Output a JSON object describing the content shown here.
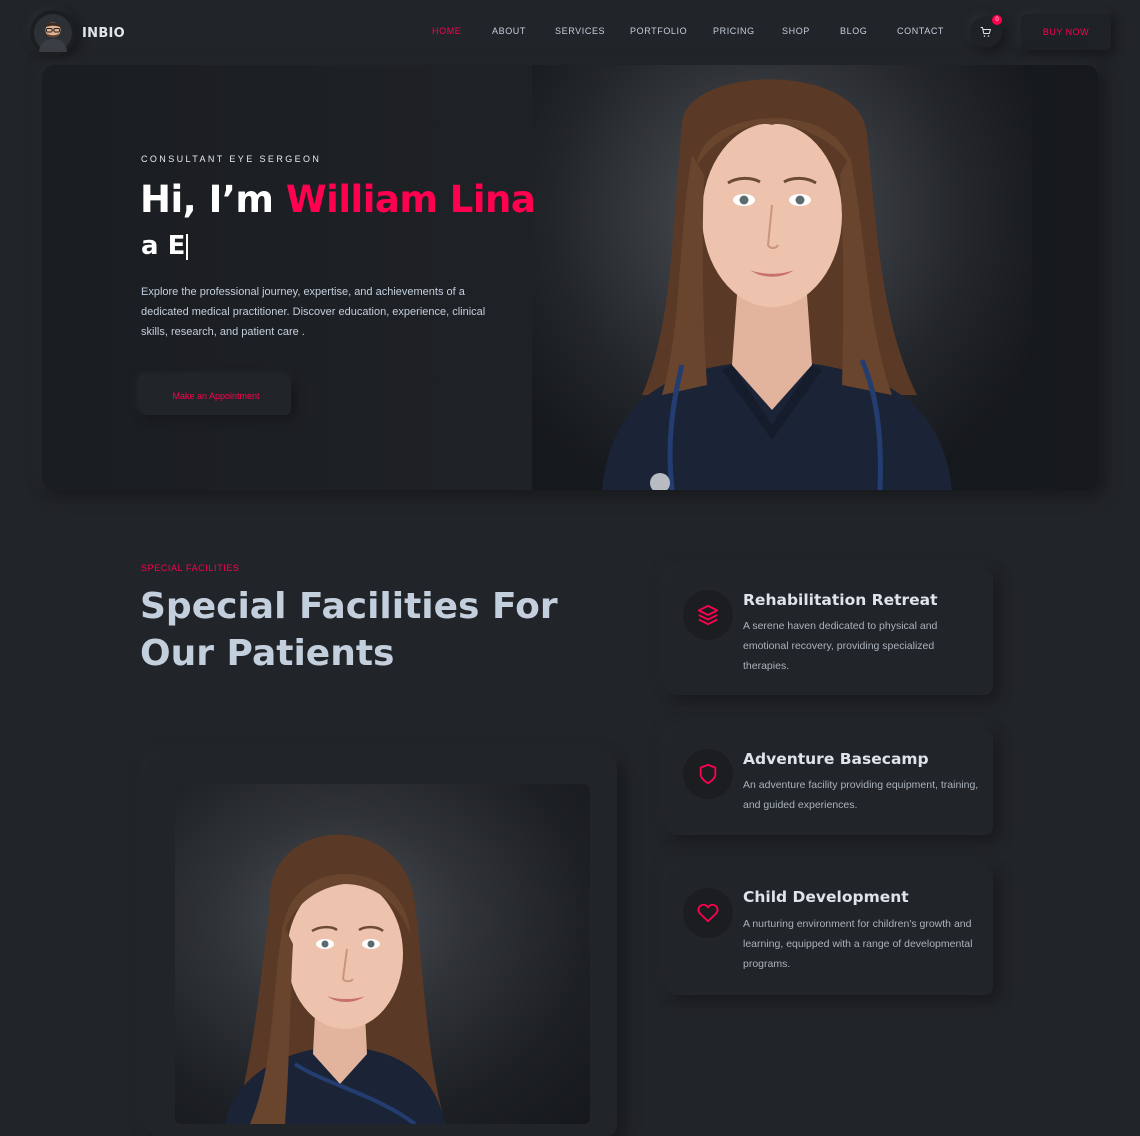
{
  "brand": {
    "name": "INBIO"
  },
  "nav": {
    "items": [
      {
        "label": "HOME",
        "active": true
      },
      {
        "label": "ABOUT",
        "active": false
      },
      {
        "label": "SERVICES",
        "active": false
      },
      {
        "label": "PORTFOLIO",
        "active": false
      },
      {
        "label": "PRICING",
        "active": false
      },
      {
        "label": "SHOP",
        "active": false
      },
      {
        "label": "BLOG",
        "active": false
      },
      {
        "label": "CONTACT",
        "active": false
      }
    ],
    "cart_count": "0",
    "buy_now_label": "BUY NOW"
  },
  "hero": {
    "subtitle": "CONSULTANT EYE SERGEON",
    "greeting": "Hi, I’m ",
    "name": "William Lina",
    "typed_text": "a E",
    "description": "Explore the professional journey, expertise, and achievements of a dedicated medical practitioner. Discover education, experience, clinical skills, research, and patient care .",
    "cta_label": "Make an Appointment"
  },
  "facilities": {
    "label": "SPECIAL FACILITIES",
    "title": "Special Facilities For Our Patients",
    "items": [
      {
        "icon": "layers-icon",
        "title": "Rehabilitation Retreat",
        "description": "A serene haven dedicated to physical and emotional recovery, providing specialized therapies."
      },
      {
        "icon": "shield-icon",
        "title": "Adventure Basecamp",
        "description": "An adventure facility providing equipment, training, and guided experiences."
      },
      {
        "icon": "heart-icon",
        "title": "Child Development",
        "description": "A nurturing environment for children's growth and learning, equipped with a range of developmental programs."
      }
    ]
  },
  "colors": {
    "background": "#212428",
    "accent": "#ff014f",
    "text": "#c4cfde"
  }
}
